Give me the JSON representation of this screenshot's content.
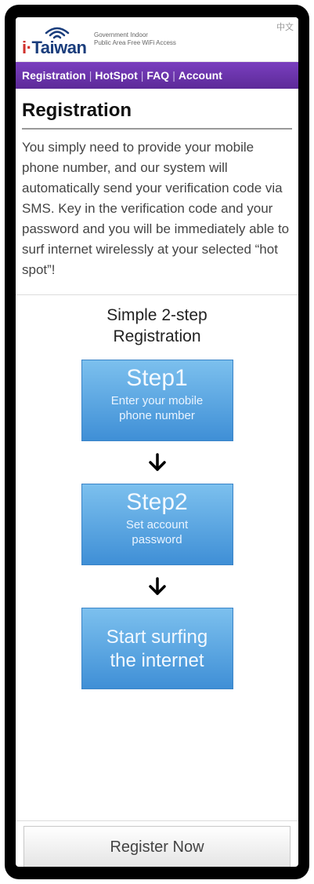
{
  "header": {
    "logo_text": "i-Taiwan",
    "logo_text_i": "i",
    "logo_text_rest": "Taiwan",
    "tagline_line1": "Government Indoor",
    "tagline_line2": "Public Area Free WiFi Access",
    "language_link": "中文"
  },
  "nav": {
    "items": [
      {
        "label": "Registration"
      },
      {
        "label": "HotSpot"
      },
      {
        "label": "FAQ"
      },
      {
        "label": "Account"
      }
    ],
    "separator": "|"
  },
  "main": {
    "title": "Registration",
    "intro": "You simply need to provide your mobile phone number, and our system will automatically send your verification code via SMS. Key in the verification code and your password and you will be immediately able to surf internet wirelessly at your selected “hot spot”!",
    "steps_heading_line1": "Simple 2-step",
    "steps_heading_line2": "Registration",
    "steps": [
      {
        "title": "Step1",
        "desc_line1": "Enter your mobile",
        "desc_line2": "phone number"
      },
      {
        "title": "Step2",
        "desc_line1": "Set account",
        "desc_line2": "password"
      },
      {
        "final_line1": "Start surfing",
        "final_line2": "the internet"
      }
    ],
    "register_button": "Register Now"
  },
  "colors": {
    "nav_purple": "#6b34ab",
    "step_blue": "#4a9ae0",
    "logo_blue": "#1a3d7c",
    "frame": "#000000"
  },
  "icons": {
    "wifi": "wifi-icon",
    "arrow": "arrow-down-icon"
  }
}
